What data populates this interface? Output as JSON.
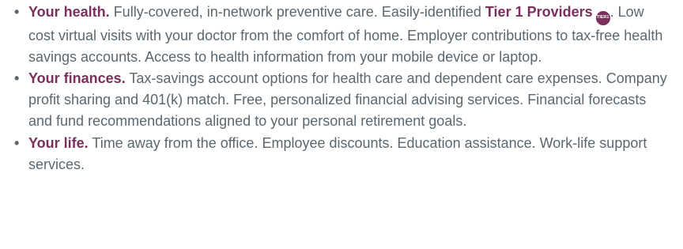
{
  "benefits": [
    {
      "title": "Your health.",
      "text_before_bold": " Fully-covered, in-network preventive care. Easily-identified ",
      "inline_bold": "Tier 1 Providers",
      "badge": {
        "top": "TIER",
        "bottom": "1",
        "color": "#7a2f5c"
      },
      "text_after": ". Low cost virtual visits with your doctor from the comfort of home. Employer contributions to tax-free health savings accounts. Access to health information from your mobile device or laptop."
    },
    {
      "title": "Your finances.",
      "text": " Tax-savings account options for health care and dependent care expenses. Company profit sharing and 401(k) match. Free, personalized financial advising services. Financial forecasts and fund recommendations aligned to your personal retirement goals."
    },
    {
      "title": "Your life.",
      "text": " Time away from the office. Employee discounts. Education assistance. Work-life support services."
    }
  ],
  "colors": {
    "heading": "#7a2f5c",
    "body_text": "#5b6770"
  },
  "bullet_glyph": "•"
}
